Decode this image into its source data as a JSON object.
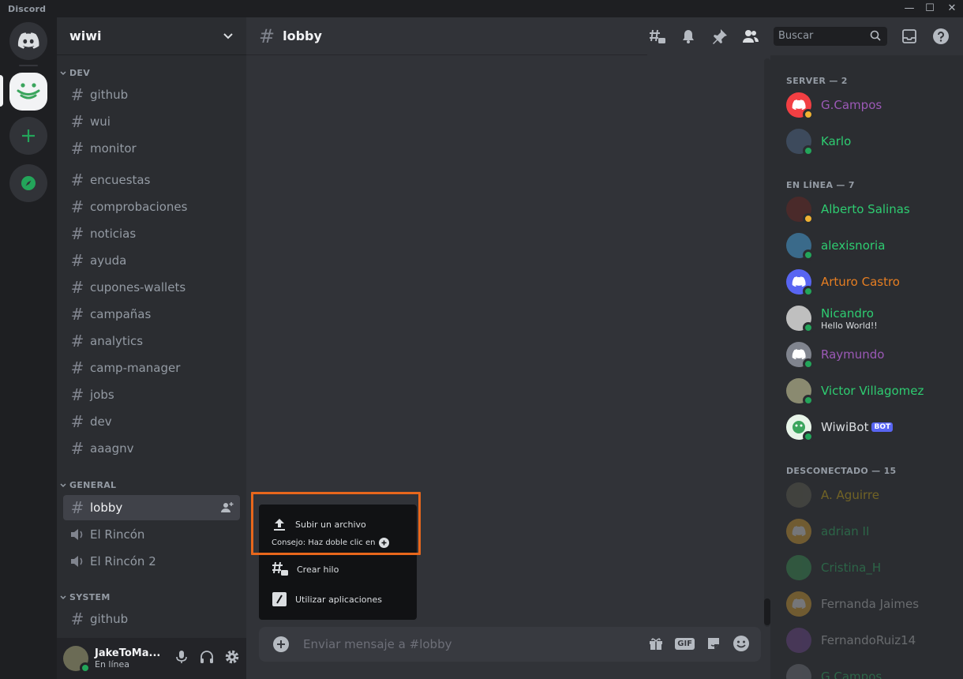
{
  "titlebar": {
    "brand": "Discord",
    "minimize": "—",
    "maximize": "☐",
    "close": "✕"
  },
  "guild": {
    "name": "wiwi"
  },
  "categories": [
    {
      "name": "DEV",
      "channels": [
        "github",
        "wui",
        "monitor",
        "encuestas",
        "comprobaciones",
        "noticias",
        "ayuda",
        "cupones-wallets",
        "campañas",
        "analytics",
        "camp-manager",
        "jobs",
        "dev",
        "aaagnv"
      ]
    },
    {
      "name": "GENERAL",
      "channels": [
        "lobby"
      ],
      "voice": [
        "El Rincón",
        "El Rincón 2"
      ]
    },
    {
      "name": "SYSTEM",
      "channels": [
        "github"
      ]
    }
  ],
  "user": {
    "name": "JakeToMa...",
    "status": "En línea"
  },
  "channel": {
    "name": "lobby"
  },
  "search": {
    "placeholder": "Buscar"
  },
  "composer": {
    "placeholder": "Enviar mensaje a #lobby",
    "gif": "GIF"
  },
  "popup": {
    "upload": "Subir un archivo",
    "tip": "Consejo: Haz doble clic en",
    "thread": "Crear hilo",
    "apps": "Utilizar aplicaciones"
  },
  "member_groups": [
    {
      "label": "SERVER — 2"
    },
    {
      "label": "EN LÍNEA — 7"
    },
    {
      "label": "DESCONECTADO — 15"
    }
  ],
  "members": [
    {
      "name": "G.Campos",
      "color": "#9b59b6"
    },
    {
      "name": "Karlo",
      "color": "#2ecc71"
    },
    {
      "name": "Alberto Salinas",
      "color": "#2ecc71"
    },
    {
      "name": "alexisnoria",
      "color": "#2ecc71"
    },
    {
      "name": "Arturo Castro",
      "color": "#e67e22"
    },
    {
      "name": "Nicandro",
      "color": "#2ecc71",
      "custom_status": "Hello World!!"
    },
    {
      "name": "Raymundo",
      "color": "#9b59b6"
    },
    {
      "name": "Victor Villagomez",
      "color": "#2ecc71"
    },
    {
      "name": "WiwiBot",
      "color": "#dbdee1",
      "tag": "BOT"
    },
    {
      "name": "A. Aguirre",
      "color": "#f1c40f"
    },
    {
      "name": "adrian II",
      "color": "#2ecc71"
    },
    {
      "name": "Cristina_H",
      "color": "#2ecc71"
    },
    {
      "name": "Fernanda Jaimes",
      "color": "#dbdee1"
    },
    {
      "name": "FernandoRuiz14",
      "color": "#dbdee1"
    },
    {
      "name": "G.Campos",
      "color": "#2ecc71"
    }
  ]
}
